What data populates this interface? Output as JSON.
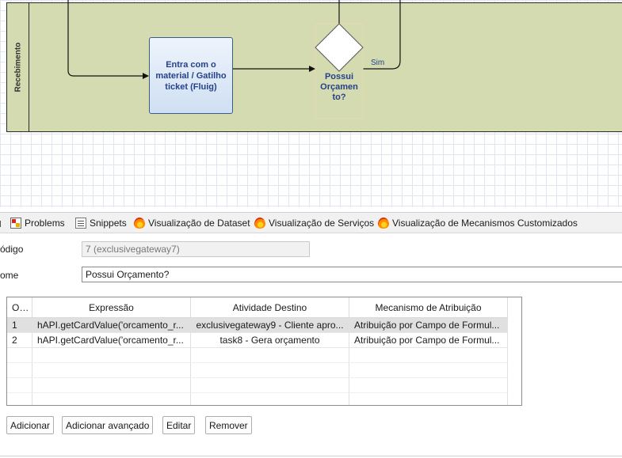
{
  "diagram": {
    "lane_label": "Recebimento",
    "task_label": "Entra com o material / Gatilho ticket (Fluig)",
    "gateway_label": "Possui Orçamen to?",
    "flow_label": "Sim",
    "colors": {
      "lane": "#d4dbb0",
      "task_fill": "#cfdff2",
      "label_text": "#25418c"
    }
  },
  "tabs": [
    {
      "label": "Problems",
      "icon": "problems-icon"
    },
    {
      "label": "Snippets",
      "icon": "snippets-icon"
    },
    {
      "label": "Visualização de Dataset",
      "icon": "flame-icon"
    },
    {
      "label": "Visualização de Serviços",
      "icon": "flame-icon"
    },
    {
      "label": "Visualização de Mecanismos Customizados",
      "icon": "flame-icon"
    }
  ],
  "form": {
    "codigo_label": "ódigo",
    "codigo_value": "7 (exclusivegateway7)",
    "nome_label": "ome",
    "nome_value": "Possui Orçamento?"
  },
  "table": {
    "headers": [
      "O...",
      "Expressão",
      "Atividade Destino",
      "Mecanismo de Atribuição"
    ],
    "rows": [
      [
        "1",
        "hAPI.getCardValue('orcamento_r...",
        "exclusivegateway9 - Cliente apro...",
        "Atribuição por Campo de Formul..."
      ],
      [
        "2",
        "hAPI.getCardValue('orcamento_r...",
        "task8 - Gera orçamento",
        "Atribuição por Campo de Formul..."
      ]
    ]
  },
  "buttons": {
    "adicionar": "Adicionar",
    "adicionar_avancado": "Adicionar avançado",
    "editar": "Editar",
    "remover": "Remover"
  }
}
